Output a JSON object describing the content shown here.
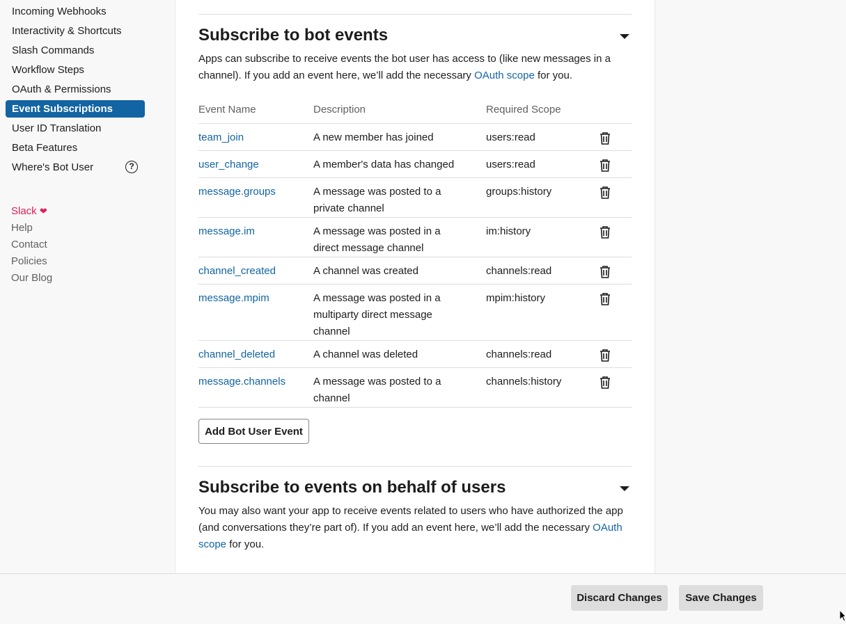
{
  "sidebar": {
    "items": [
      {
        "label": "Incoming Webhooks"
      },
      {
        "label": "Interactivity & Shortcuts"
      },
      {
        "label": "Slash Commands"
      },
      {
        "label": "Workflow Steps"
      },
      {
        "label": "OAuth & Permissions"
      },
      {
        "label": "Event Subscriptions",
        "active": true
      },
      {
        "label": "User ID Translation"
      },
      {
        "label": "Beta Features"
      },
      {
        "label": "Where's Bot User",
        "icon": "help-circle-icon"
      }
    ],
    "footer_links": [
      {
        "label": "Slack",
        "icon": "heart-icon"
      },
      {
        "label": "Help"
      },
      {
        "label": "Contact"
      },
      {
        "label": "Policies"
      },
      {
        "label": "Our Blog"
      }
    ]
  },
  "bot_events": {
    "title": "Subscribe to bot events",
    "desc_prefix": "Apps can subscribe to receive events the bot user has access to (like new messages in a channel). If you add an event here, we’ll add the necessary ",
    "desc_link": "OAuth scope",
    "desc_suffix": " for you.",
    "columns": [
      "Event Name",
      "Description",
      "Required Scope"
    ],
    "rows": [
      {
        "name": "team_join",
        "description": "A new member has joined",
        "scope": "users:read"
      },
      {
        "name": "user_change",
        "description": "A member's data has changed",
        "scope": "users:read"
      },
      {
        "name": "message.groups",
        "description": "A message was posted to a private channel",
        "scope": "groups:history"
      },
      {
        "name": "message.im",
        "description": "A message was posted in a direct message channel",
        "scope": "im:history"
      },
      {
        "name": "channel_created",
        "description": "A channel was created",
        "scope": "channels:read"
      },
      {
        "name": "message.mpim",
        "description": "A message was posted in a multiparty direct message channel",
        "scope": "mpim:history"
      },
      {
        "name": "channel_deleted",
        "description": "A channel was deleted",
        "scope": "channels:read"
      },
      {
        "name": "message.channels",
        "description": "A message was posted to a channel",
        "scope": "channels:history"
      }
    ],
    "add_button": "Add Bot User Event"
  },
  "user_events": {
    "title": "Subscribe to events on behalf of users",
    "desc_prefix": "You may also want your app to receive events related to users who have authorized the app (and conversations they’re part of). If you add an event here, we’ll add the necessary ",
    "desc_link": "OAuth scope",
    "desc_suffix": " for you."
  },
  "footer": {
    "discard_label": "Discard Changes",
    "save_label": "Save Changes"
  },
  "colors": {
    "accent": "#1264a3",
    "slack_heart": "#e01e5a"
  }
}
